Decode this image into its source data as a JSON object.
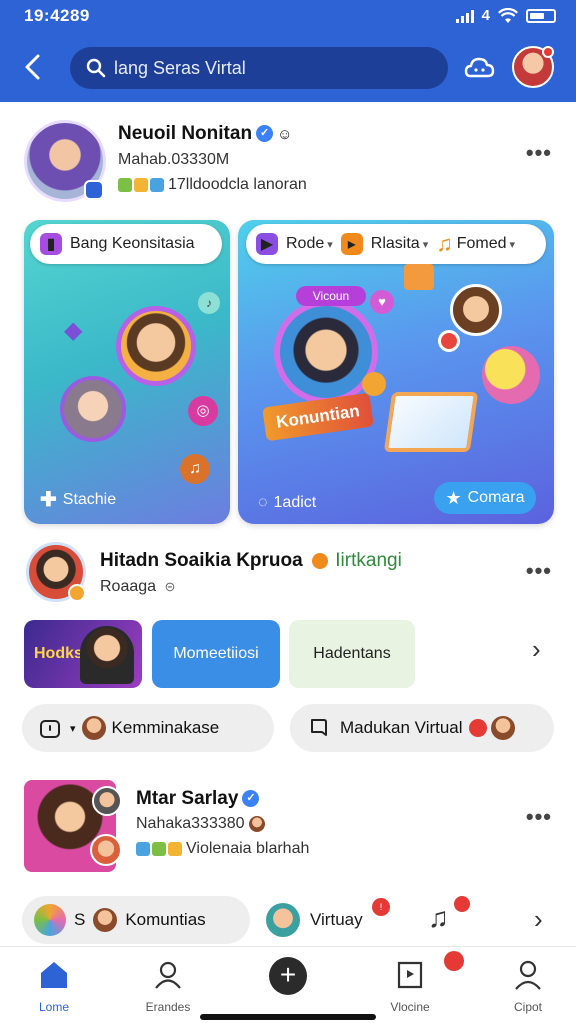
{
  "status_bar": {
    "time": "19:4289",
    "signal_label": "4"
  },
  "header": {
    "search_text": "lang Seras Virtal"
  },
  "post1": {
    "name": "Neuoil Nonitan",
    "subtitle": "Mahab.03330M",
    "meta": "17lldoodcla lanoran"
  },
  "banner_left": {
    "pill_label": "Bang Keonsitasia",
    "footer_label": "Stachie"
  },
  "banner_right": {
    "pills": [
      "Rode",
      "Rlasita",
      "Fomed"
    ],
    "top_label": "Vicoun",
    "center_label": "Konuntian",
    "footer_label": "1adict",
    "action_label": "Comara"
  },
  "post2": {
    "name": "Hitadn Soaikia Kpruoa",
    "tag": "Iirtkangi",
    "subtitle": "Roaaga"
  },
  "tiles": [
    "Hodks",
    "Momeetiiosi",
    "Hadentans"
  ],
  "chips": {
    "left": "Kemminakase",
    "right": "Madukan Virtual"
  },
  "post3": {
    "name": "Mtar Sarlay",
    "subtitle": "Nahaka333380",
    "meta": "Violenaia blarhah"
  },
  "bottom_chips": {
    "letter": "S",
    "komunitas": "Komuntias",
    "virtual": "Virtuay"
  },
  "nav": {
    "items": [
      "Lome",
      "Erandes",
      "Vlocine",
      "Cipot"
    ]
  },
  "colors": {
    "brand": "#2e63d6",
    "accent": "#3aa0f0"
  }
}
